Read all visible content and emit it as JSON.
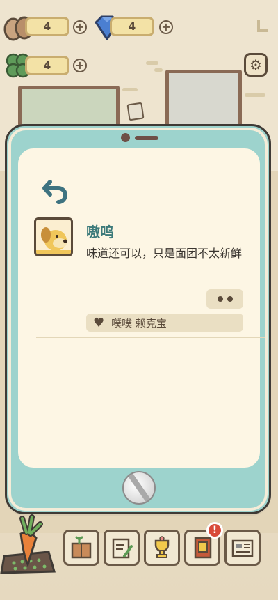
{
  "hud": {
    "eggs": "4",
    "gems": "4",
    "clovers": "4"
  },
  "icons": {
    "egg": "egg-icon",
    "gem": "gem-icon",
    "clover": "clover-icon",
    "settings": "gear-icon"
  },
  "phone": {
    "message": {
      "sender": "嗷呜",
      "text": "味道还可以，只是面团不太新鲜",
      "likes_text": "噗噗 赖克宝"
    }
  },
  "dock": {
    "items": [
      {
        "name": "furniture-button"
      },
      {
        "name": "notes-button"
      },
      {
        "name": "trophy-button"
      },
      {
        "name": "book-button"
      },
      {
        "name": "newspaper-button"
      }
    ]
  },
  "colors": {
    "phone_body": "#9dd3cd",
    "screen": "#fdf6e4",
    "sender_name": "#3c7a7a",
    "alert": "#d94a3a"
  }
}
